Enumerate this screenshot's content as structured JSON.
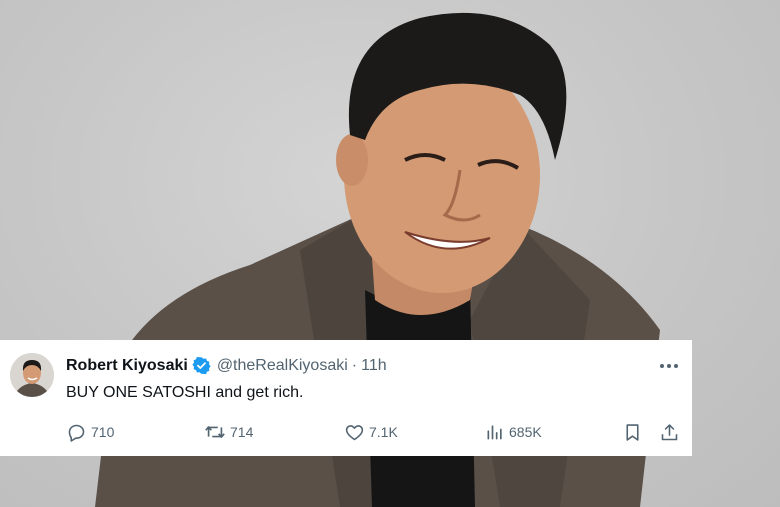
{
  "tweet": {
    "author_name": "Robert Kiyosaki",
    "handle": "@theRealKiyosaki",
    "separator": "·",
    "time": "11h",
    "text": "BUY ONE SATOSHI and get rich.",
    "verified": true,
    "stats": {
      "replies": "710",
      "retweets": "714",
      "likes": "7.1K",
      "views": "685K"
    },
    "icons": {
      "verified": "verified-badge-icon",
      "more": "more-options-icon",
      "reply": "reply-icon",
      "retweet": "retweet-icon",
      "like": "heart-icon",
      "views": "views-icon",
      "bookmark": "bookmark-icon",
      "share": "share-icon"
    }
  },
  "colors": {
    "verified_blue": "#1d9bf0",
    "text_primary": "#0f1419",
    "text_secondary": "#536471",
    "background_photo": "#c9c9c9"
  }
}
